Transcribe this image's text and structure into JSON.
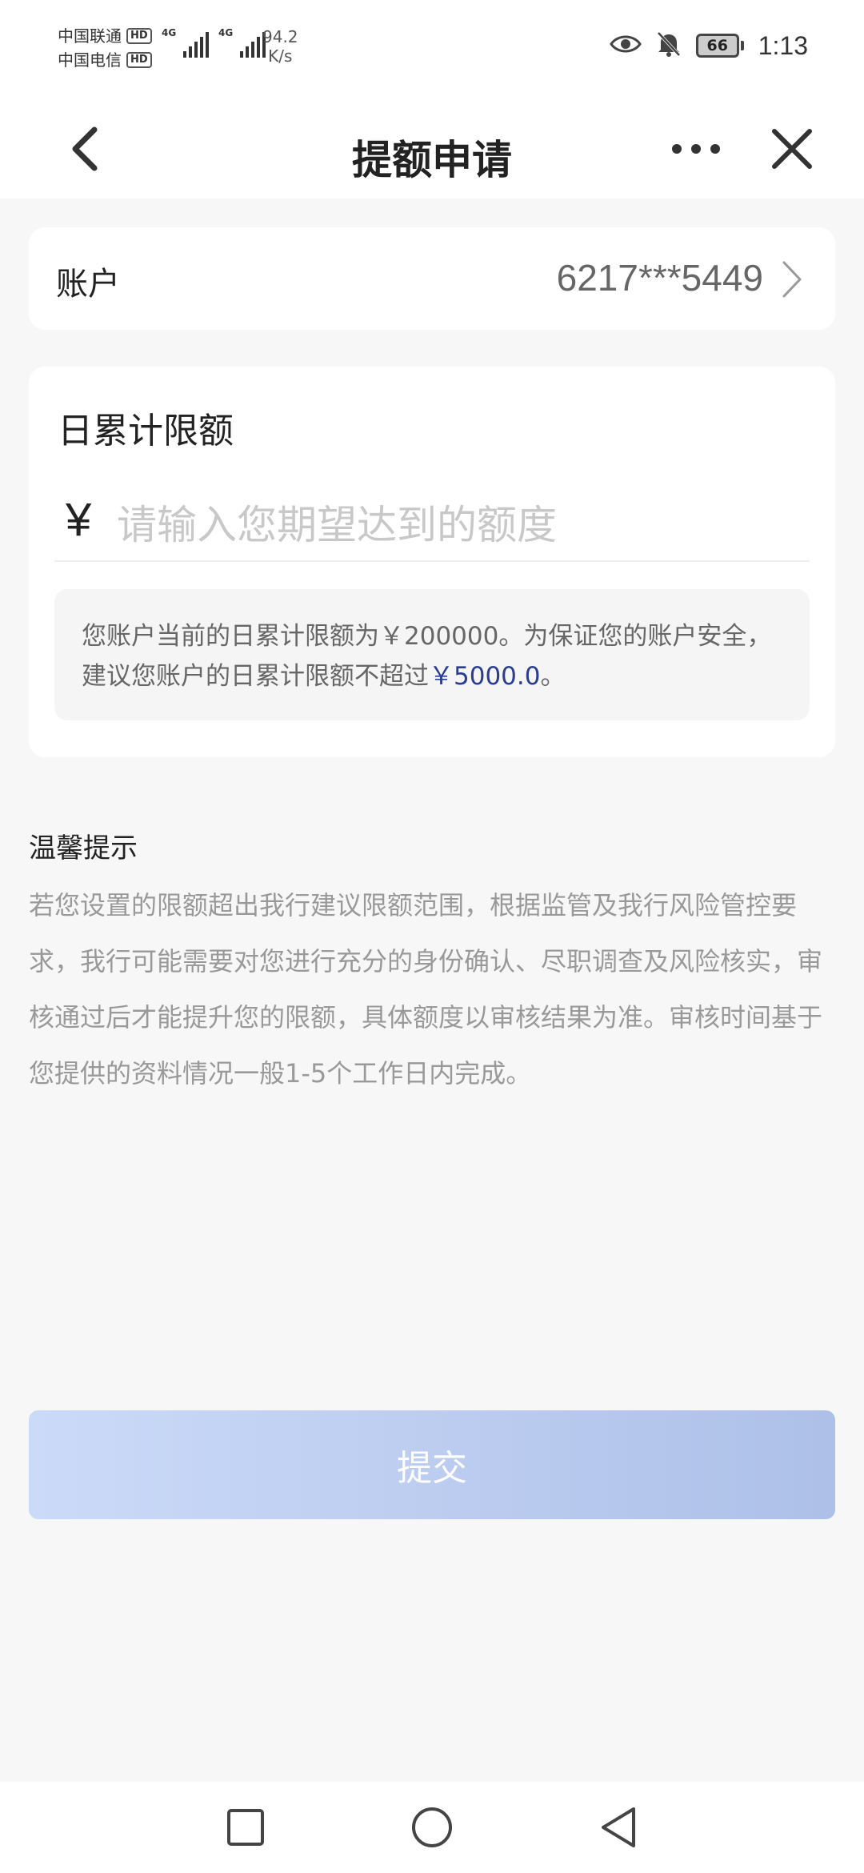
{
  "status_bar": {
    "carrier_1": "中国联通",
    "carrier_2": "中国电信",
    "hd_badge": "HD",
    "network_label": "4G",
    "speed_value": "94.2",
    "speed_unit": "K/s",
    "battery_level": "66",
    "time": "1:13"
  },
  "header": {
    "title": "提额申请",
    "back_icon": "chevron-left-icon",
    "more_icon": "more-horizontal-icon",
    "close_icon": "close-icon"
  },
  "account": {
    "label": "账户",
    "value": "6217***5449"
  },
  "limit": {
    "title": "日累计限额",
    "currency_symbol": "¥",
    "input_value": "",
    "input_placeholder": "请输入您期望达到的额度",
    "notice_prefix": "您账户当前的日累计限额为￥200000。为保证您的账户安全，建议您账户的日累计限额不超过",
    "notice_highlight": "￥5000.0",
    "notice_suffix": "。"
  },
  "tips": {
    "title": "温馨提示",
    "body": "若您设置的限额超出我行建议限额范围，根据监管及我行风险管控要求，我行可能需要对您进行充分的身份确认、尽职调查及风险核实，审核通过后才能提升您的限额，具体额度以审核结果为准。审核时间基于您提供的资料情况一般1-5个工作日内完成。"
  },
  "submit": {
    "label": "提交",
    "enabled": false
  },
  "colors": {
    "accent_text": "#2b3d8f",
    "button_gradient_start": "#cbdaf8",
    "button_gradient_end": "#adc0e8",
    "page_background": "#f7f7f7"
  }
}
